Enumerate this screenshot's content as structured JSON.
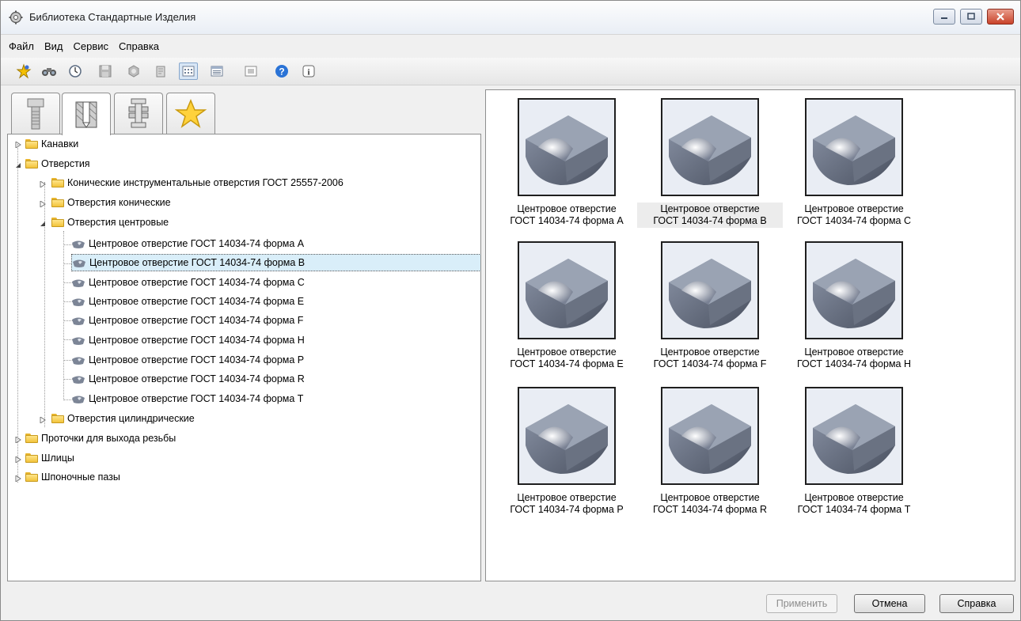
{
  "window": {
    "title": "Библиотека Стандартные Изделия"
  },
  "menu": [
    "Файл",
    "Вид",
    "Сервис",
    "Справка"
  ],
  "toolbar": {
    "icons": [
      "pin-star-icon",
      "binoculars-icon",
      "clock-icon",
      "save-icon",
      "gear-nut-icon",
      "document-icon",
      "view-grid-icon",
      "view-list-icon",
      "view-details-icon",
      "help-icon",
      "info-icon"
    ]
  },
  "tabs": [
    "bolt-icon",
    "hole-icon",
    "assembly-icon",
    "favorites-star-icon"
  ],
  "tree": {
    "kanavki": "Канавки",
    "otverstiya": "Отверстия",
    "konich_instr": "Конические инструментальные отверстия ГОСТ 25557-2006",
    "otv_konich": "Отверстия конические",
    "otv_centr": "Отверстия центровые",
    "items": [
      "Центровое отверстие ГОСТ 14034-74 форма A",
      "Центровое отверстие ГОСТ 14034-74 форма B",
      "Центровое отверстие ГОСТ 14034-74 форма C",
      "Центровое отверстие ГОСТ 14034-74 форма E",
      "Центровое отверстие ГОСТ 14034-74 форма F",
      "Центровое отверстие ГОСТ 14034-74 форма H",
      "Центровое отверстие ГОСТ 14034-74 форма P",
      "Центровое отверстие ГОСТ 14034-74 форма R",
      "Центровое отверстие ГОСТ 14034-74 форма T"
    ],
    "otv_cilindr": "Отверстия цилиндрические",
    "protochki": "Проточки для выхода резьбы",
    "shlicy": "Шлицы",
    "shponochnye": "Шпоночные пазы",
    "selected_index": 1
  },
  "thumbs": [
    {
      "line1": "Центровое отверстие",
      "line2": "ГОСТ 14034-74 форма A"
    },
    {
      "line1": "Центровое отверстие",
      "line2": "ГОСТ 14034-74 форма B"
    },
    {
      "line1": "Центровое отверстие",
      "line2": "ГОСТ 14034-74 форма C"
    },
    {
      "line1": "Центровое отверстие",
      "line2": "ГОСТ 14034-74 форма E"
    },
    {
      "line1": "Центровое отверстие",
      "line2": "ГОСТ 14034-74 форма F"
    },
    {
      "line1": "Центровое отверстие",
      "line2": "ГОСТ 14034-74 форма H"
    },
    {
      "line1": "Центровое отверстие",
      "line2": "ГОСТ 14034-74 форма P"
    },
    {
      "line1": "Центровое отверстие",
      "line2": "ГОСТ 14034-74 форма R"
    },
    {
      "line1": "Центровое отверстие",
      "line2": "ГОСТ 14034-74 форма T"
    }
  ],
  "buttons": {
    "apply": "Применить",
    "cancel": "Отмена",
    "help": "Справка"
  },
  "colors": {
    "selection": "#d9eef9",
    "folder": "#f2c33b"
  }
}
